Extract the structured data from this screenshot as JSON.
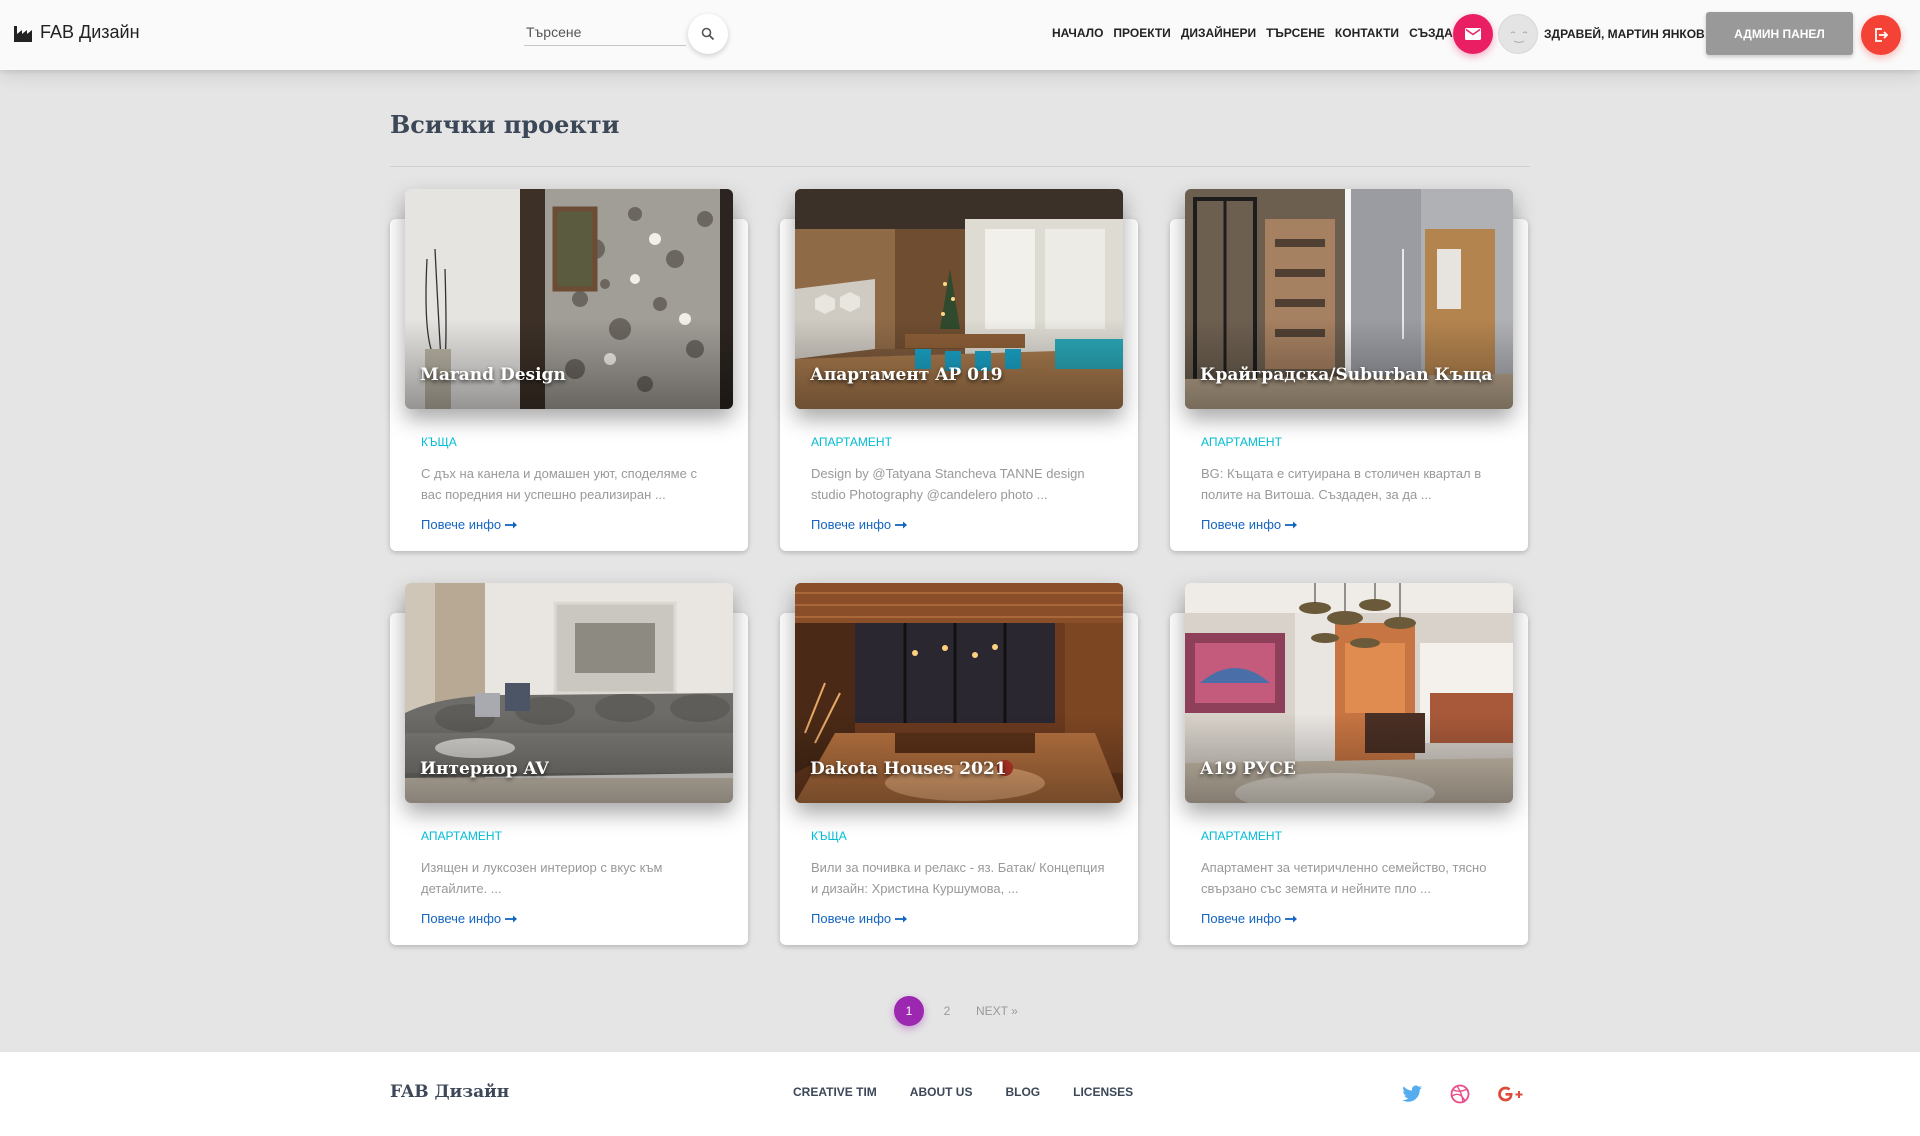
{
  "navbar": {
    "brand": "FAB Дизайн",
    "search_placeholder": "Търсене",
    "links": [
      "НАЧАЛО",
      "ПРОЕКТИ",
      "ДИЗАЙНЕРИ",
      "ТЪРСЕНЕ",
      "КОНТАКТИ",
      "СЪЗДАЙ"
    ],
    "greeting": "ЗДРАВЕЙ, МАРТИН ЯНКОВ!",
    "admin_label": "АДМИН ПАНЕЛ"
  },
  "main": {
    "title": "Всички проекти",
    "more_label": "Повече инфо",
    "cards": [
      {
        "title": "Marand Design",
        "category": "КЪЩА",
        "description": "С дъх на канела и домашен уют, споделяме с вас поредния ни успешно реализиран ..."
      },
      {
        "title": "Апартамент AP 019",
        "category": "АПАРТАМЕНТ",
        "description": "Design by @Tatyana Stancheva TANNE design studio Photography @candelero photo ..."
      },
      {
        "title": "Крайградска/Suburban Къща",
        "category": "АПАРТАМЕНТ",
        "description": "BG: Къщата е ситуирана в столичен квартал в полите на Витоша. Създаден, за да ..."
      },
      {
        "title": "Интериор AV",
        "category": "АПАРТАМЕНТ",
        "description": "Изящен и луксозен интериор с вкус към детайлите. ..."
      },
      {
        "title": "Dakota Houses 2021",
        "category": "КЪЩА",
        "description": "Вили за почивка и релакс - яз. Батак/ Концепция и дизайн: Христина Куршумова, ..."
      },
      {
        "title": "A19 РУСЕ",
        "category": "АПАРТАМЕНТ",
        "description": "Апартамент за четиричленно семейство, тясно свързано със земята и нейните пло ..."
      }
    ]
  },
  "pagination": {
    "pages": [
      "1",
      "2"
    ],
    "active": "1",
    "next": "NEXT »"
  },
  "footer": {
    "brand": "FAB Дизайн",
    "links": [
      "CREATIVE TIM",
      "ABOUT US",
      "BLOG",
      "LICENSES"
    ]
  },
  "colors": {
    "accent_purple": "#9c27b0",
    "mail_pink": "#e91e63",
    "logout_red": "#f44336",
    "category_cyan": "#00bcd4",
    "link_blue": "#1565c0",
    "admin_gray": "#999999",
    "twitter": "#55acee",
    "dribbble": "#ea4c89",
    "google_plus": "#dd4b39"
  },
  "icons": [
    "factory-icon",
    "search-icon",
    "mail-icon",
    "avatar-face-icon",
    "logout-icon",
    "arrow-right-icon",
    "twitter-icon",
    "dribbble-icon",
    "google-plus-icon"
  ]
}
